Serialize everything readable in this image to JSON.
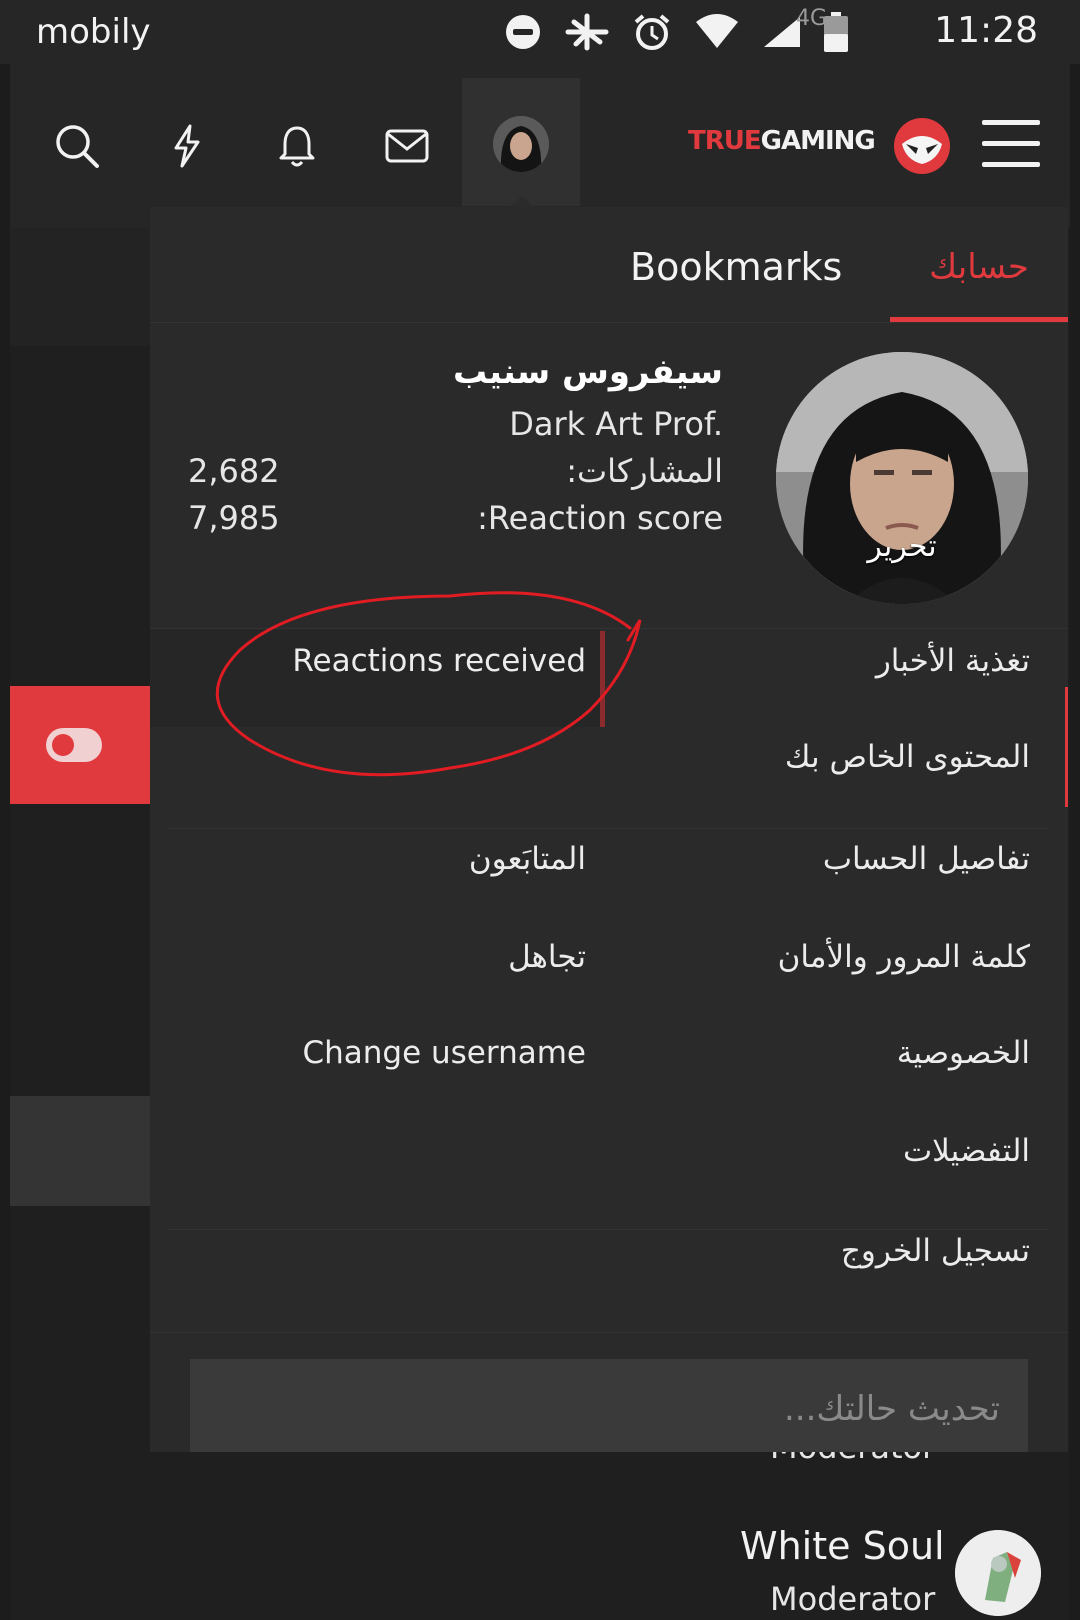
{
  "status_bar": {
    "carrier": "mobily",
    "network_type": "4G",
    "time": "11:28",
    "icons": [
      "do-not-disturb-icon",
      "flight-off-icon",
      "alarm-icon",
      "wifi-icon",
      "signal-icon",
      "battery-icon"
    ]
  },
  "header": {
    "logo_part1": "TRUE",
    "logo_part2": "GAMING",
    "icons": [
      "search-icon",
      "bolt-icon",
      "bell-icon",
      "mail-icon",
      "avatar",
      "logo-mask-icon",
      "hamburger-icon"
    ]
  },
  "panel": {
    "tab_account": "حسابك",
    "tab_bookmarks": "Bookmarks",
    "profile": {
      "username": "سيفروس سنيب",
      "user_title": "Dark Art Prof.",
      "posts_label": "المشاركات:",
      "posts_value": "2,682",
      "reaction_score_label": ":Reaction score",
      "reaction_score_value": "7,985",
      "edit_label": "تحرير"
    },
    "menu": {
      "news_feed": "تغذية الأخبار",
      "reactions_received": "Reactions received",
      "your_content": "المحتوى الخاص بك",
      "account_details": "تفاصيل الحساب",
      "following": "المتابَعون",
      "password_security": "كلمة المرور والأمان",
      "ignoring": "تجاهل",
      "privacy": "الخصوصية",
      "change_username": "Change username",
      "preferences": "التفضيلات",
      "log_out": "تسجيل الخروج"
    },
    "status_placeholder": "تحديث حالتك..."
  },
  "background_members": [
    {
      "role": "Moderator"
    },
    {
      "name": "White Soul",
      "role": "Moderator"
    }
  ],
  "colors": {
    "accent": "#e0393e",
    "panel_bg": "#2a2a2a",
    "header_bg": "#262626"
  }
}
